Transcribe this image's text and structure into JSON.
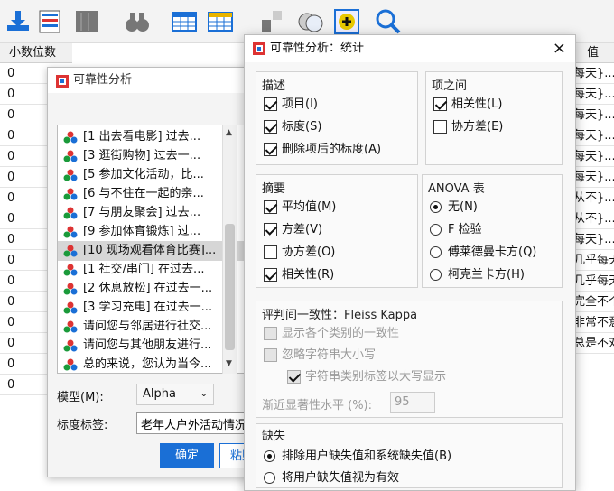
{
  "grid": {
    "header_left": "小数位数",
    "header_right": "值",
    "left_values": [
      "0",
      "0",
      "0",
      "0",
      "0",
      "0",
      "0",
      "0",
      "0",
      "0",
      "0",
      "0",
      "0",
      "0",
      "0",
      "0"
    ],
    "right_values": [
      "每天}...",
      "每天}...",
      "每天}...",
      "每天}...",
      "每天}...",
      "每天}...",
      "从不}...",
      "从不}...",
      "每天}...",
      "几乎每天",
      "几乎每天",
      "完全不个",
      "非常不意",
      "总是不对"
    ]
  },
  "reliability_dialog": {
    "title": "可靠性分析",
    "items": [
      "[1 出去看电影] 过去...",
      "[3 逛街购物] 过去一...",
      "[5 参加文化活动，比...",
      "[6 与不住在一起的亲...",
      "[7 与朋友聚会] 过去...",
      "[9 参加体育锻炼] 过...",
      "[10 现场观看体育比赛]...",
      "[1 社交/串门] 在过去...",
      "[2 休息放松] 在过去一...",
      "[3 学习充电] 在过去一...",
      "请问您与邻居进行社交...",
      "请问您与其他朋友进行...",
      "总的来说，您认为当今..."
    ],
    "model_label": "模型(M):",
    "model_value": "Alpha",
    "scale_label": "标度标签:",
    "scale_value": "老年人户外活动情况",
    "ok": "确定",
    "paste": "粘贴"
  },
  "stats_dialog": {
    "title": "可靠性分析：统计",
    "close": "×",
    "describe": {
      "title": "描述",
      "items": [
        {
          "label": "项目(I)",
          "checked": true
        },
        {
          "label": "标度(S)",
          "checked": true
        },
        {
          "label": "删除项后的标度(A)",
          "checked": true
        }
      ]
    },
    "between": {
      "title": "项之间",
      "items": [
        {
          "label": "相关性(L)",
          "checked": true
        },
        {
          "label": "协方差(E)",
          "checked": false
        }
      ]
    },
    "summary": {
      "title": "摘要",
      "items": [
        {
          "label": "平均值(M)",
          "checked": true
        },
        {
          "label": "方差(V)",
          "checked": true
        },
        {
          "label": "协方差(O)",
          "checked": false
        },
        {
          "label": "相关性(R)",
          "checked": true
        }
      ]
    },
    "anova": {
      "title": "ANOVA 表",
      "items": [
        {
          "label": "无(N)",
          "selected": true
        },
        {
          "label": "F 检验",
          "selected": false
        },
        {
          "label": "傅莱德曼卡方(Q)",
          "selected": false
        },
        {
          "label": "柯克兰卡方(H)",
          "selected": false
        }
      ]
    },
    "kappa": {
      "title": "评判间一致性：Fleiss Kappa",
      "opt1": "显示各个类别的一致性",
      "opt2": "忽略字符串大小写",
      "opt3": "字符串类别标签以大写显示",
      "sig_label": "渐近显著性水平 (%):",
      "sig_value": "95"
    },
    "missing": {
      "title": "缺失",
      "opt1": "排除用户缺失值和系统缺失值(B)",
      "opt2": "将用户缺失值视为有效"
    }
  },
  "colors": {
    "accent": "#1a6fd6",
    "selected_row": "#d6d6d6"
  }
}
